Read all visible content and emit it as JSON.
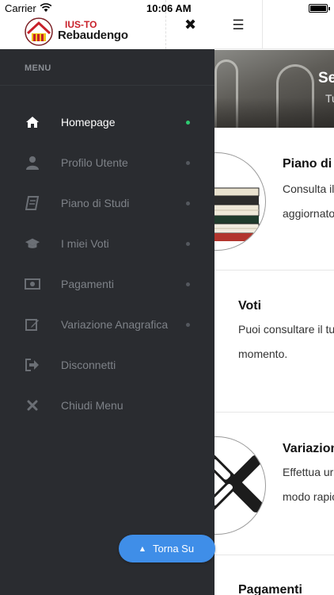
{
  "status_bar": {
    "carrier": "Carrier",
    "time": "10:06 AM"
  },
  "app": {
    "logo_top": "IUS-TO",
    "logo_bottom": "Rebaudengo",
    "hamburger_icon": "hamburger-icon",
    "close_icon": "close-icon"
  },
  "drawer": {
    "heading": "MENU",
    "items": [
      {
        "label": "Homepage",
        "icon": "home-icon",
        "active": true
      },
      {
        "label": "Profilo Utente",
        "icon": "user-icon",
        "active": false
      },
      {
        "label": "Piano di Studi",
        "icon": "book-icon",
        "active": false
      },
      {
        "label": "I miei Voti",
        "icon": "graduation-cap-icon",
        "active": false
      },
      {
        "label": "Pagamenti",
        "icon": "money-icon",
        "active": false
      },
      {
        "label": "Variazione Anagrafica",
        "icon": "edit-icon",
        "active": false
      },
      {
        "label": "Disconnetti",
        "icon": "sign-out-icon",
        "active": false
      },
      {
        "label": "Chiudi Menu",
        "icon": "close-icon",
        "active": false
      }
    ],
    "back_to_top": "Torna Su"
  },
  "main": {
    "hero_title": "Se",
    "hero_subtitle": "Tu",
    "cards": [
      {
        "title": "Piano di S",
        "text_line1": "Consulta il",
        "text_line2": "aggiornato"
      },
      {
        "title": "Voti",
        "text_line1": "Puoi consultare il tu",
        "text_line2": "momento."
      },
      {
        "title": "Variazion",
        "text_line1": "Effettua ur",
        "text_line2": "modo rapic"
      },
      {
        "title": "Pagamenti"
      }
    ]
  },
  "colors": {
    "drawer_bg": "#2a2c30",
    "active_dot": "#2ecc71",
    "button_blue": "#3f8ee8",
    "logo_red": "#c8202a"
  }
}
